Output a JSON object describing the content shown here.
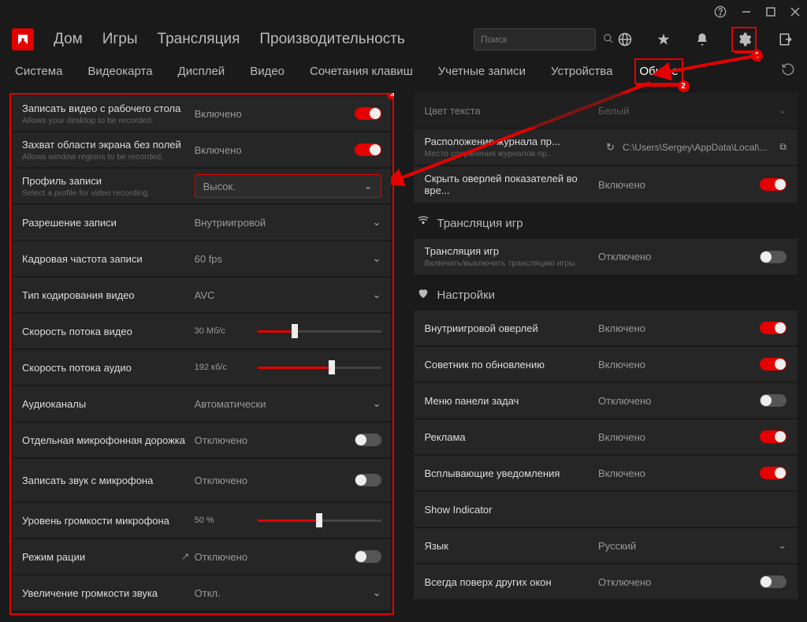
{
  "titlebar": {
    "help": "?",
    "min": "—",
    "max": "□",
    "close": "✕"
  },
  "nav": {
    "home": "Дом",
    "games": "Игры",
    "stream": "Трансляция",
    "perf": "Производительность"
  },
  "search": {
    "placeholder": "Поиск"
  },
  "subnav": {
    "system": "Система",
    "gpu": "Видеокарта",
    "display": "Дисплей",
    "video": "Видео",
    "hotkeys": "Сочетания клавиш",
    "accounts": "Учетные записи",
    "devices": "Устройства",
    "general": "Общее"
  },
  "left": {
    "rec_desktop": {
      "lbl": "Записать видео с рабочего стола",
      "sub": "Allows your desktop to be recorded.",
      "val": "Включено"
    },
    "rec_region": {
      "lbl": "Захват области экрана без полей",
      "sub": "Allows window regions to be recorded.",
      "val": "Включено"
    },
    "profile": {
      "lbl": "Профиль записи",
      "sub": "Select a profile for video recording.",
      "val": "Высок."
    },
    "resolution": {
      "lbl": "Разрешение записи",
      "val": "Внутриигровой"
    },
    "fps": {
      "lbl": "Кадровая частота записи",
      "val": "60 fps"
    },
    "enc": {
      "lbl": "Тип кодирования видео",
      "val": "AVC"
    },
    "v_bitrate": {
      "lbl": "Скорость потока видео",
      "val": "30 Мб/с"
    },
    "a_bitrate": {
      "lbl": "Скорость потока аудио",
      "val": "192 кб/с"
    },
    "a_channels": {
      "lbl": "Аудиоканалы",
      "val": "Автоматически"
    },
    "mic_track": {
      "lbl": "Отдельная микрофонная дорожка",
      "val": "Отключено"
    },
    "mic_rec": {
      "lbl": "Записать звук с микрофона",
      "val": "Отключено"
    },
    "mic_vol": {
      "lbl": "Уровень громкости микрофона",
      "val": "50 %"
    },
    "ptt": {
      "lbl": "Режим рации",
      "val": "Отключено"
    },
    "boost": {
      "lbl": "Увеличение громкости звука",
      "val": "Откл."
    }
  },
  "right": {
    "text_color": {
      "lbl": "Цвет текста",
      "val": "Белый"
    },
    "log_loc": {
      "lbl": "Расположение журнала пр...",
      "sub": "Место сохранения журналов пр...",
      "val": "C:\\Users\\Sergey\\AppData\\Local\\..."
    },
    "hide_overlay": {
      "lbl": "Скрыть оверлей показателей во вре...",
      "val": "Включено"
    },
    "stream_head": "Трансляция игр",
    "stream": {
      "lbl": "Трансляция игр",
      "sub": "Включить/выключить трансляцию игры",
      "val": "Отключено"
    },
    "settings_head": "Настройки",
    "ingame": {
      "lbl": "Внутриигровой оверлей",
      "val": "Включено"
    },
    "advisor": {
      "lbl": "Советник по обновлению",
      "val": "Включено"
    },
    "taskbar": {
      "lbl": "Меню панели задач",
      "val": "Отключено"
    },
    "ads": {
      "lbl": "Реклама",
      "val": "Включено"
    },
    "toasts": {
      "lbl": "Всплывающие уведомления",
      "val": "Включено"
    },
    "indicator": {
      "lbl": "Show Indicator"
    },
    "lang": {
      "lbl": "Язык",
      "val": "Русский"
    },
    "ontop": {
      "lbl": "Всегда поверх других окон",
      "val": "Отключено"
    }
  }
}
